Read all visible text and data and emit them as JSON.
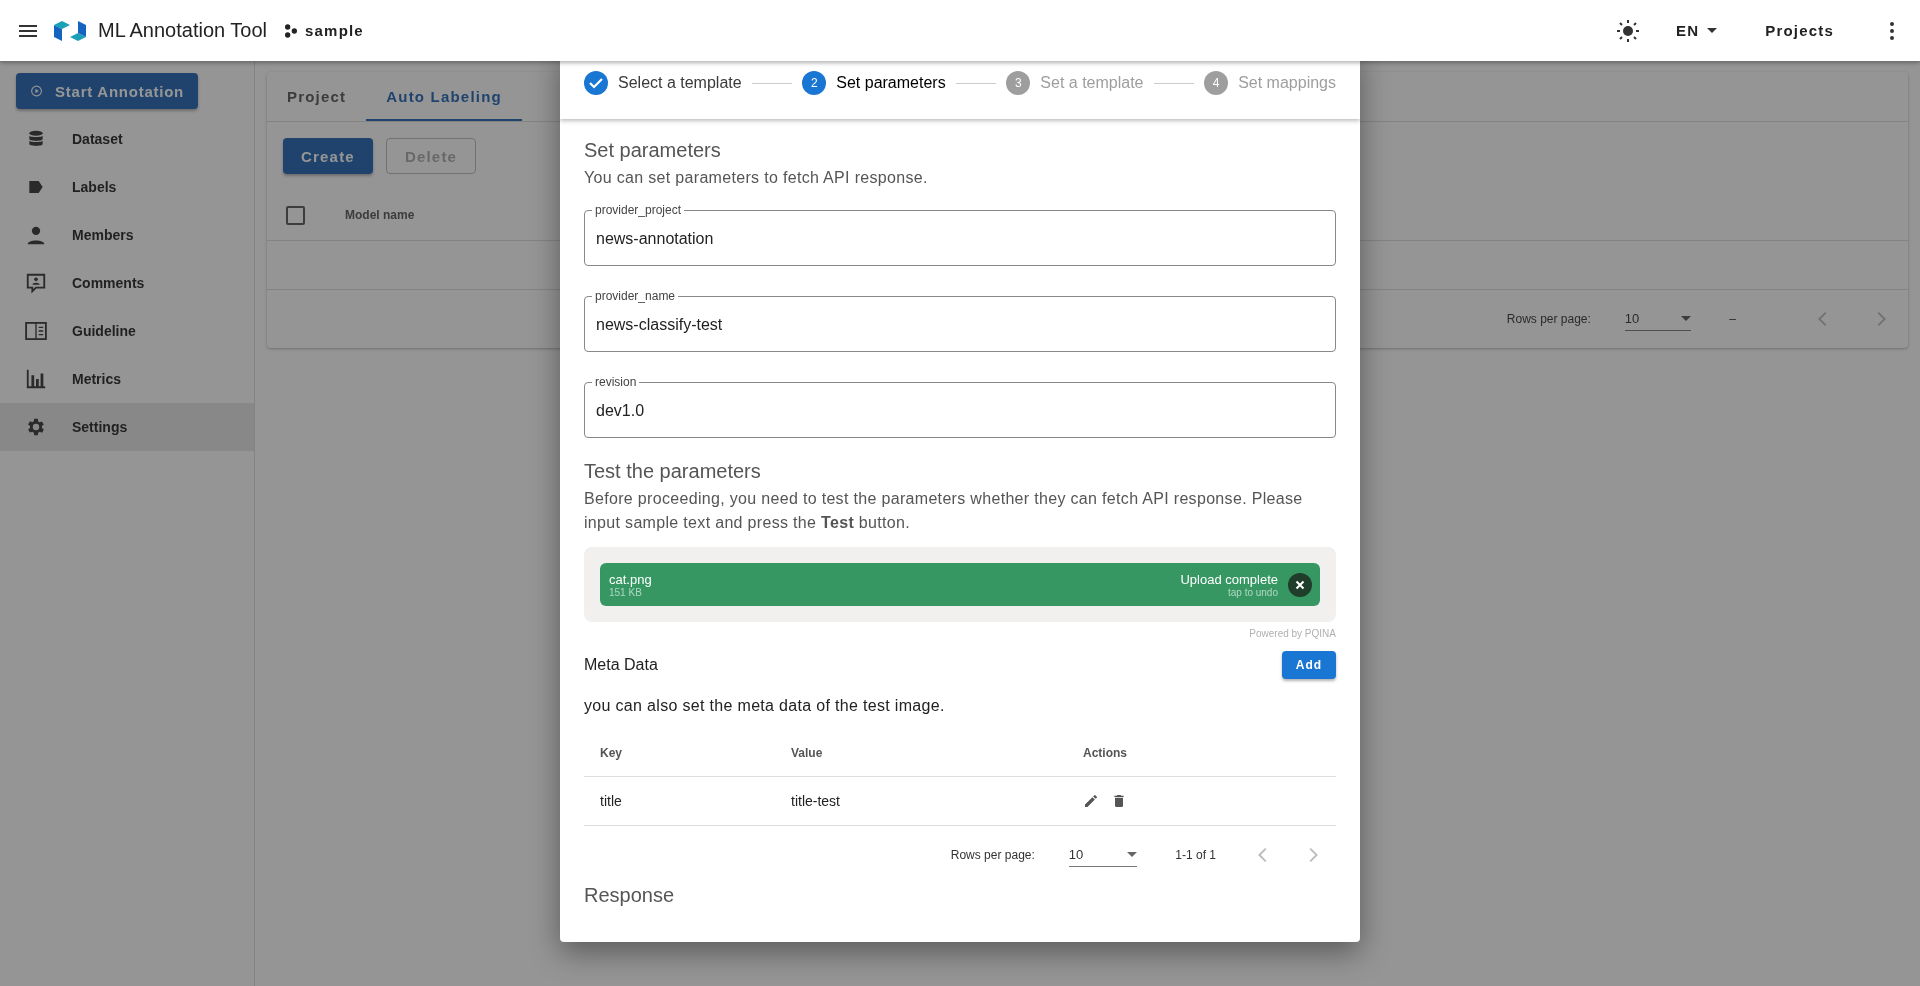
{
  "app_bar": {
    "title": "ML Annotation Tool",
    "project": "sample",
    "language": "EN",
    "projects": "Projects"
  },
  "sidebar": {
    "start_button": "Start Annotation",
    "items": [
      {
        "label": "Dataset",
        "selected": false
      },
      {
        "label": "Labels",
        "selected": false
      },
      {
        "label": "Members",
        "selected": false
      },
      {
        "label": "Comments",
        "selected": false
      },
      {
        "label": "Guideline",
        "selected": false
      },
      {
        "label": "Metrics",
        "selected": false
      },
      {
        "label": "Settings",
        "selected": true
      }
    ]
  },
  "tabs": [
    {
      "label": "Project",
      "selected": false
    },
    {
      "label": "Auto Labeling",
      "selected": true
    }
  ],
  "toolbar": [
    {
      "label": "Create",
      "disabled": false
    },
    {
      "label": "Delete",
      "disabled": true
    }
  ],
  "table": {
    "select_all_checked": false,
    "columns": [
      "Model name"
    ],
    "footer": {
      "rows_per_page_label": "Rows per page:",
      "rows_per_page": "10",
      "range": "–"
    }
  },
  "dialog": {
    "steps": [
      {
        "label": "Select a template",
        "done": true,
        "selected": false
      },
      {
        "number": "2",
        "label": "Set parameters",
        "done": false,
        "selected": true
      },
      {
        "number": "3",
        "label": "Set a template",
        "done": false,
        "selected": false
      },
      {
        "number": "4",
        "label": "Set mappings",
        "done": false,
        "selected": false
      }
    ],
    "title": "Set parameters",
    "description": "You can set parameters to fetch API response.",
    "fields": [
      {
        "label": "provider_project",
        "value": "news-annotation"
      },
      {
        "label": "provider_name",
        "value": "news-classify-test"
      },
      {
        "label": "revision",
        "value": "dev1.0"
      }
    ],
    "test_title": "Test the parameters",
    "test_description": "Before proceeding, you need to test the parameters whether they can fetch API response. Please input sample text and press the **Test** button.",
    "upload": {
      "file_name": "cat.png",
      "size": "151 KB",
      "status": "Upload complete",
      "hint": "tap to undo"
    },
    "powered_by": "Powered by PQINA",
    "meta_title": "Meta Data",
    "add_button": "Add",
    "meta_description": "you can also set the meta data of the test image.",
    "meta_table": {
      "columns": [
        "Key",
        "Value",
        "Actions"
      ],
      "rows": [
        {
          "key": "title",
          "value": "title-test"
        }
      ],
      "footer": {
        "rows_per_page_label": "Rows per page:",
        "rows_per_page": "10",
        "range": "1-1 of 1"
      }
    },
    "response_title": "Response"
  }
}
